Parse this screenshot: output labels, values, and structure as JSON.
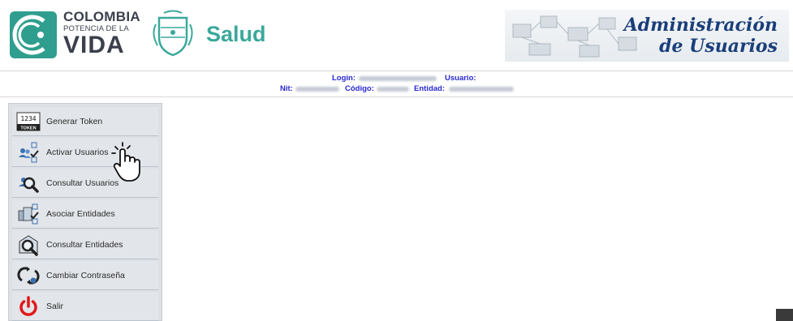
{
  "header": {
    "colombia_line1": "COLOMBIA",
    "colombia_line2": "POTENCIA DE LA",
    "colombia_line3": "VIDA",
    "ministry": "Salud",
    "app_title_line1": "Administración",
    "app_title_line2": "de Usuarios",
    "brand_color": "#3aa89b",
    "title_color": "#1a3e7a"
  },
  "session": {
    "login_label": "Login:",
    "usuario_label": "Usuario:",
    "nit_label": "Nit:",
    "codigo_label": "Código:",
    "entidad_label": "Entidad:",
    "label_color": "#2727d0"
  },
  "sidebar": {
    "items": [
      {
        "label": "Generar Token",
        "icon": "token-icon"
      },
      {
        "label": "Activar Usuarios",
        "icon": "activate-users-icon"
      },
      {
        "label": "Consultar Usuarios",
        "icon": "search-users-icon"
      },
      {
        "label": "Asociar Entidades",
        "icon": "associate-entities-icon"
      },
      {
        "label": "Consultar Entidades",
        "icon": "search-entities-icon"
      },
      {
        "label": "Cambiar Contraseña",
        "icon": "change-password-icon"
      },
      {
        "label": "Salir",
        "icon": "power-icon"
      }
    ]
  },
  "token_icon_text": {
    "digits": "1234",
    "caption": "TOKEN"
  },
  "cursor": {
    "icon": "hand-pointer-icon"
  }
}
